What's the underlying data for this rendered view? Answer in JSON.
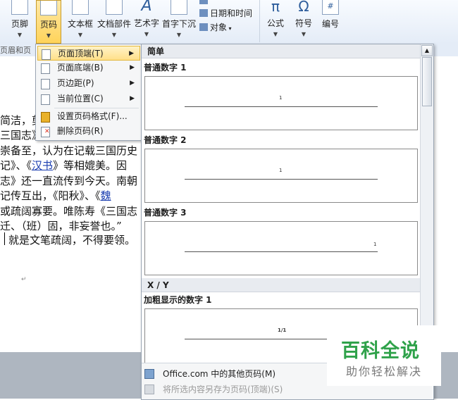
{
  "ribbon": {
    "buttons": [
      {
        "label": "页脚"
      },
      {
        "label": "页码"
      },
      {
        "label": "文本框"
      },
      {
        "label": "文档部件"
      },
      {
        "label": "艺术字"
      },
      {
        "label": "首字下沉"
      },
      {
        "label": "公式"
      },
      {
        "label": "符号"
      },
      {
        "label": "编号"
      }
    ],
    "small": {
      "datetime": "日期和时间",
      "object": "对象"
    },
    "group_label": "页眉和页"
  },
  "menu": {
    "items": [
      {
        "label": "页面顶端(T)"
      },
      {
        "label": "页面底端(B)"
      },
      {
        "label": "页边距(P)"
      },
      {
        "label": "当前位置(C)"
      },
      {
        "label": "设置页码格式(F)..."
      },
      {
        "label": "删除页码(R)"
      }
    ]
  },
  "gallery": {
    "section_simple": "简单",
    "section_xy": "X / Y",
    "entries": [
      {
        "title": "普通数字 1",
        "number": "1"
      },
      {
        "title": "普通数字 2",
        "number": "1"
      },
      {
        "title": "普通数字 3",
        "number": "1"
      },
      {
        "title": "加粗显示的数字 1",
        "number": "1/1"
      }
    ],
    "footer": {
      "more": "Office.com 中的其他页码(M)",
      "save": "将所选内容另存为页码(顶端)(S)"
    }
  },
  "document": {
    "lines": [
      {
        "pre": "简洁，剪",
        "link": "",
        "post": ""
      },
      {
        "pre": "三国志》",
        "link": "",
        "post": ""
      },
      {
        "pre": "崇备至，认为在记载三国历史",
        "link": "",
        "post": ""
      },
      {
        "pre": "记》、《",
        "link": "汉书",
        "post": "》等相媲美。因"
      },
      {
        "pre": "志》还一直流传到今天。南朝",
        "link": "",
        "post": ""
      },
      {
        "pre": " 记传互出，《阳秋》、《",
        "link": "魏",
        "post": ""
      },
      {
        "pre": "或疏阔寡要。唯陈寿《三国志",
        "link": "",
        "post": ""
      },
      {
        "pre": "迁、（班）固，非妄誉也。”",
        "link": "",
        "post": ""
      },
      {
        "pre": "就是文笔疏阔，不得要领。",
        "link": "",
        "post": ""
      }
    ]
  },
  "watermark": {
    "title": "百科全说",
    "subtitle": "助你轻松解决"
  }
}
